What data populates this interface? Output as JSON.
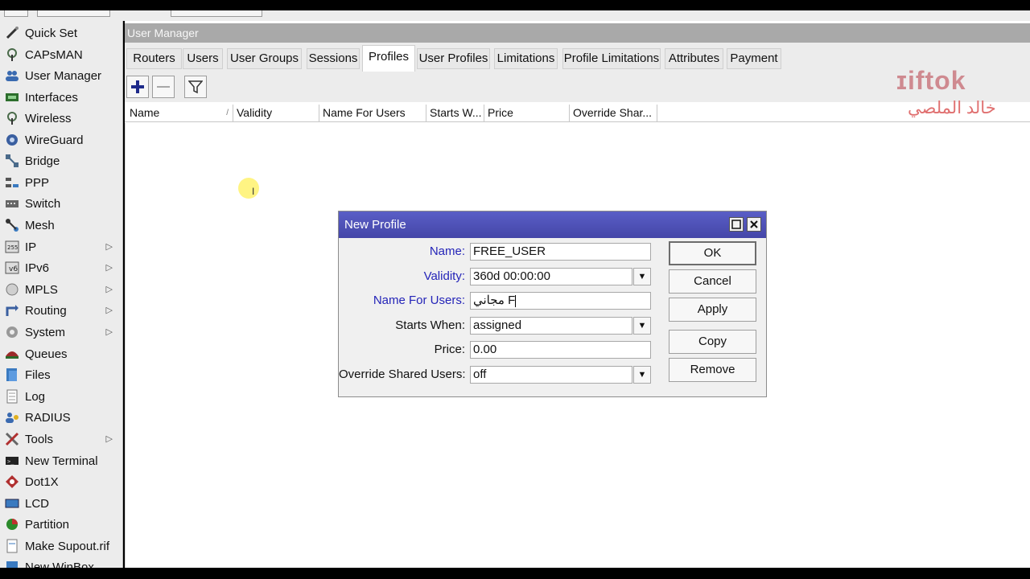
{
  "window": {
    "title": "User Manager"
  },
  "sidebar": {
    "items": [
      {
        "label": "Quick Set",
        "icon": "wand-icon",
        "submenu": false
      },
      {
        "label": "CAPsMAN",
        "icon": "antenna-icon",
        "submenu": false
      },
      {
        "label": "User Manager",
        "icon": "users-icon",
        "submenu": false
      },
      {
        "label": "Interfaces",
        "icon": "interfaces-icon",
        "submenu": false
      },
      {
        "label": "Wireless",
        "icon": "wireless-icon",
        "submenu": false
      },
      {
        "label": "WireGuard",
        "icon": "wireguard-icon",
        "submenu": false
      },
      {
        "label": "Bridge",
        "icon": "bridge-icon",
        "submenu": false
      },
      {
        "label": "PPP",
        "icon": "ppp-icon",
        "submenu": false
      },
      {
        "label": "Switch",
        "icon": "switch-icon",
        "submenu": false
      },
      {
        "label": "Mesh",
        "icon": "mesh-icon",
        "submenu": false
      },
      {
        "label": "IP",
        "icon": "ip-icon",
        "submenu": true
      },
      {
        "label": "IPv6",
        "icon": "ipv6-icon",
        "submenu": true
      },
      {
        "label": "MPLS",
        "icon": "mpls-icon",
        "submenu": true
      },
      {
        "label": "Routing",
        "icon": "routing-icon",
        "submenu": true
      },
      {
        "label": "System",
        "icon": "gear-icon",
        "submenu": true
      },
      {
        "label": "Queues",
        "icon": "queues-icon",
        "submenu": false
      },
      {
        "label": "Files",
        "icon": "folder-icon",
        "submenu": false
      },
      {
        "label": "Log",
        "icon": "log-icon",
        "submenu": false
      },
      {
        "label": "RADIUS",
        "icon": "radius-icon",
        "submenu": false
      },
      {
        "label": "Tools",
        "icon": "tools-icon",
        "submenu": true
      },
      {
        "label": "New Terminal",
        "icon": "terminal-icon",
        "submenu": false
      },
      {
        "label": "Dot1X",
        "icon": "dot1x-icon",
        "submenu": false
      },
      {
        "label": "LCD",
        "icon": "lcd-icon",
        "submenu": false
      },
      {
        "label": "Partition",
        "icon": "partition-icon",
        "submenu": false
      },
      {
        "label": "Make Supout.rif",
        "icon": "supout-icon",
        "submenu": false
      },
      {
        "label": "New WinBox",
        "icon": "winbox-icon",
        "submenu": false
      }
    ]
  },
  "tabs": [
    {
      "label": "Routers",
      "active": false
    },
    {
      "label": "Users",
      "active": false
    },
    {
      "label": "User Groups",
      "active": false
    },
    {
      "label": "Sessions",
      "active": false
    },
    {
      "label": "Profiles",
      "active": true
    },
    {
      "label": "User Profiles",
      "active": false
    },
    {
      "label": "Limitations",
      "active": false
    },
    {
      "label": "Profile Limitations",
      "active": false
    },
    {
      "label": "Attributes",
      "active": false
    },
    {
      "label": "Payment",
      "active": false
    }
  ],
  "table": {
    "columns": [
      "Name",
      "Validity",
      "Name For Users",
      "Starts W...",
      "Price",
      "Override Shar..."
    ],
    "sort_indicator": "/"
  },
  "watermark": {
    "logo": "ɪiftok",
    "name": "خالد الملصي"
  },
  "dialog": {
    "title": "New Profile",
    "fields": {
      "name": {
        "label": "Name:",
        "value": "FREE_USER"
      },
      "validity": {
        "label": "Validity:",
        "value": "360d 00:00:00"
      },
      "name_for_users": {
        "label": "Name For Users:",
        "value": "مجاني F"
      },
      "starts_when": {
        "label": "Starts When:",
        "value": "assigned"
      },
      "price": {
        "label": "Price:",
        "value": "0.00"
      },
      "override_shared_users": {
        "label": "Override Shared Users:",
        "value": "off"
      }
    },
    "buttons": {
      "ok": "OK",
      "cancel": "Cancel",
      "apply": "Apply",
      "copy": "Copy",
      "remove": "Remove"
    }
  },
  "colors": {
    "dialog_title_bg": "#4a4db4",
    "blue_label": "#2424b8",
    "add_icon": "#1e2a8a",
    "watermark": "#d0777f",
    "cursor_highlight": "#fff05a"
  }
}
